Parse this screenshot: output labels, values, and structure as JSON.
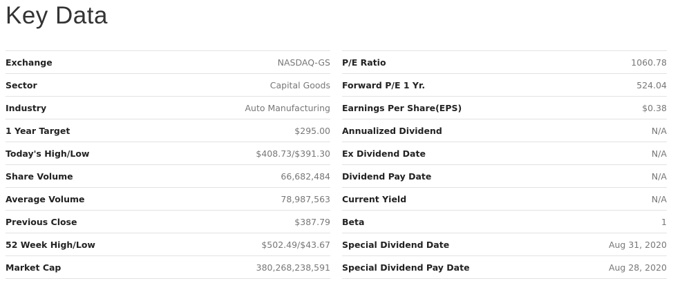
{
  "title": "Key Data",
  "left_table": {
    "rows": [
      {
        "label": "Exchange",
        "value": "NASDAQ-GS"
      },
      {
        "label": "Sector",
        "value": "Capital Goods"
      },
      {
        "label": "Industry",
        "value": "Auto Manufacturing"
      },
      {
        "label": "1 Year Target",
        "value": "$295.00"
      },
      {
        "label": "Today's High/Low",
        "value": "$408.73/$391.30"
      },
      {
        "label": "Share Volume",
        "value": "66,682,484"
      },
      {
        "label": "Average Volume",
        "value": "78,987,563"
      },
      {
        "label": "Previous Close",
        "value": "$387.79"
      },
      {
        "label": "52 Week High/Low",
        "value": "$502.49/$43.67"
      },
      {
        "label": "Market Cap",
        "value": "380,268,238,591"
      }
    ]
  },
  "right_table": {
    "rows": [
      {
        "label": "P/E Ratio",
        "value": "1060.78"
      },
      {
        "label": "Forward P/E 1 Yr.",
        "value": "524.04"
      },
      {
        "label": "Earnings Per Share(EPS)",
        "value": "$0.38"
      },
      {
        "label": "Annualized Dividend",
        "value": "N/A"
      },
      {
        "label": "Ex Dividend Date",
        "value": "N/A"
      },
      {
        "label": "Dividend Pay Date",
        "value": "N/A"
      },
      {
        "label": "Current Yield",
        "value": "N/A"
      },
      {
        "label": "Beta",
        "value": "1"
      },
      {
        "label": "Special Dividend Date",
        "value": "Aug 31, 2020"
      },
      {
        "label": "Special Dividend Pay Date",
        "value": "Aug 28, 2020"
      }
    ]
  }
}
